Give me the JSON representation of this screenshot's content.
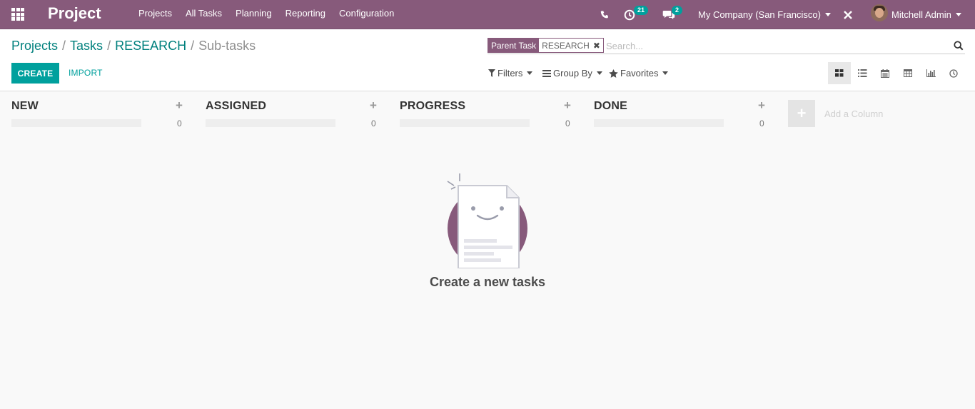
{
  "navbar": {
    "brand": "Project",
    "menu": [
      "Projects",
      "All Tasks",
      "Planning",
      "Reporting",
      "Configuration"
    ],
    "activity_count": "21",
    "message_count": "2",
    "company": "My Company (San Francisco)",
    "user": "Mitchell Admin",
    "color": "#875a7b"
  },
  "breadcrumb": {
    "items": [
      "Projects",
      "Tasks",
      "RESEARCH"
    ],
    "separator": "/",
    "current": "Sub-tasks"
  },
  "actions": {
    "create_label": "CREATE",
    "import_label": "IMPORT",
    "accent": "#00a09d"
  },
  "search": {
    "facet_label": "Parent Task",
    "facet_value": "RESEARCH",
    "placeholder": "Search..."
  },
  "search_options": {
    "filters": "Filters",
    "group_by": "Group By",
    "favorites": "Favorites"
  },
  "views": [
    "kanban-icon",
    "list-icon",
    "calendar-icon",
    "pivot-icon",
    "graph-icon",
    "activity-icon"
  ],
  "kanban": {
    "columns": [
      {
        "title": "NEW",
        "count": "0"
      },
      {
        "title": "ASSIGNED",
        "count": "0"
      },
      {
        "title": "PROGRESS",
        "count": "0"
      },
      {
        "title": "DONE",
        "count": "0"
      }
    ],
    "add_column_label": "Add a Column",
    "empty_title": "Create a new tasks"
  }
}
